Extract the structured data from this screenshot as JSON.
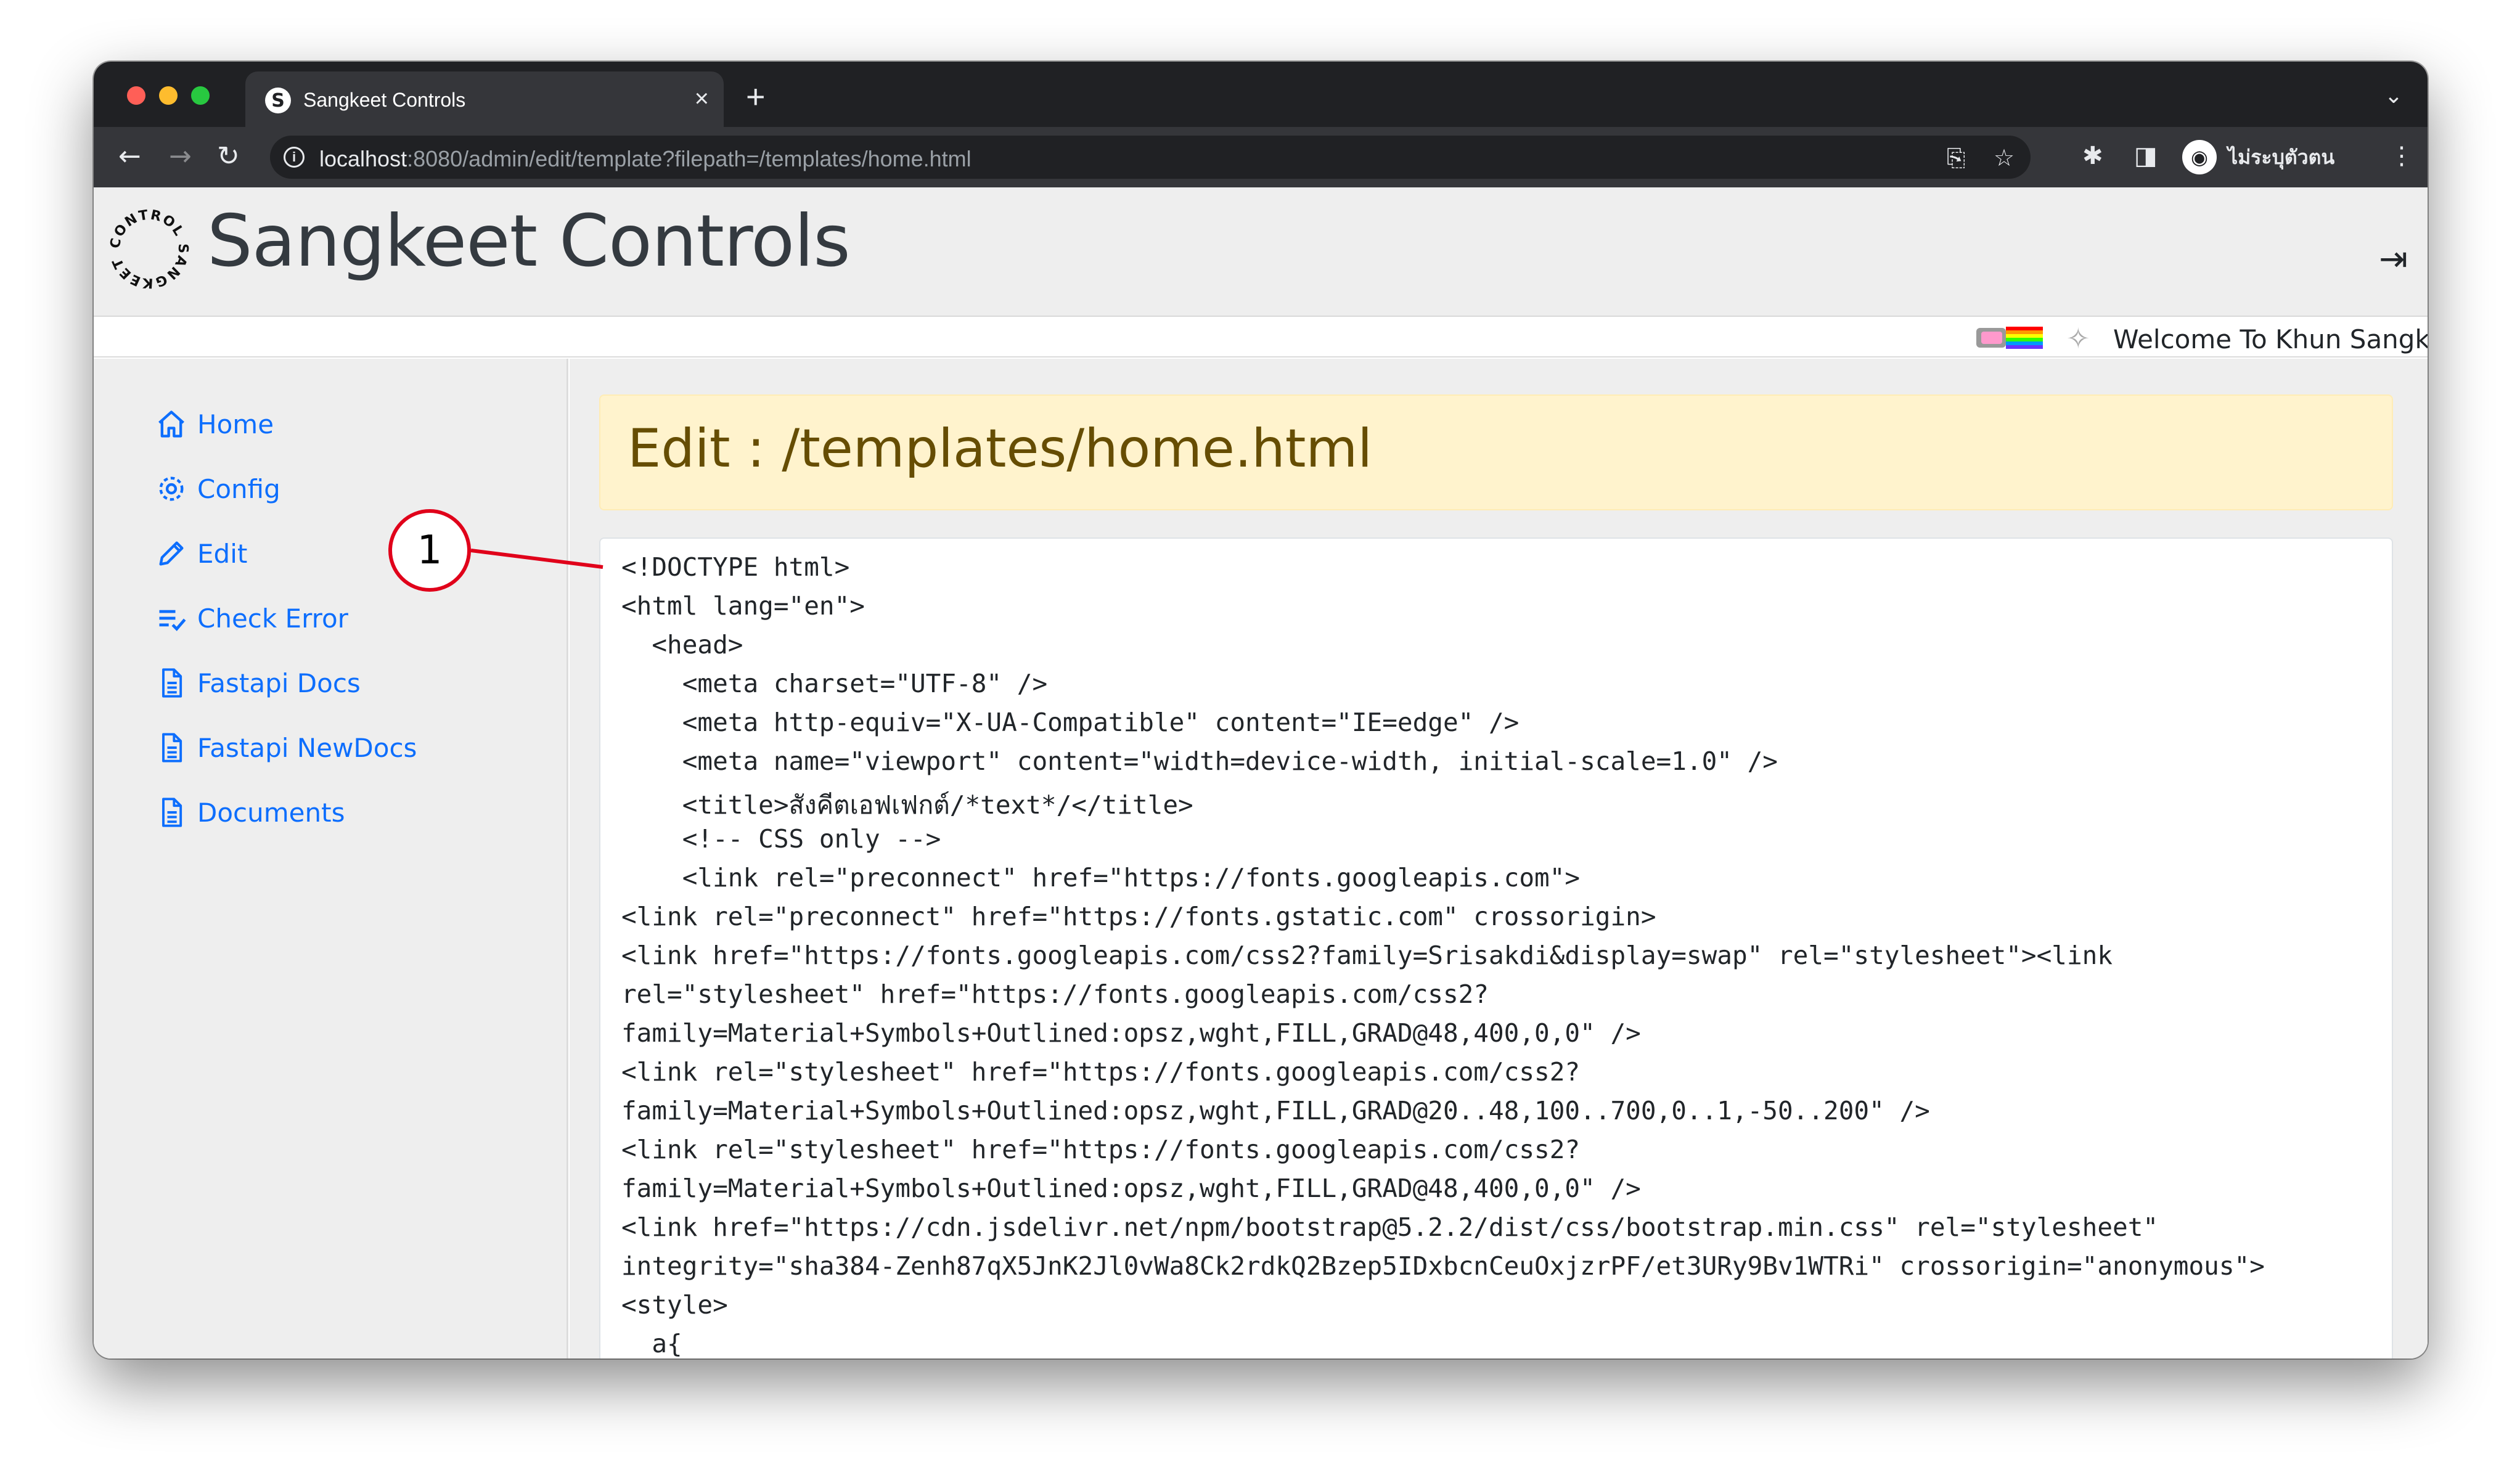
{
  "browser": {
    "tab_title": "Sangkeet Controls",
    "tab_close": "×",
    "new_tab": "+",
    "tab_menu": "⌄",
    "url_host": "localhost",
    "url_rest": ":8080/admin/edit/template?filepath=/templates/home.html",
    "profile_name": "ไม่ระบุตัวตน"
  },
  "app": {
    "title": "Sangkeet Controls",
    "logo_text": "CONTROL SANGKEET",
    "welcome": "Welcome To Khun Sangkeet"
  },
  "sidebar": {
    "items": [
      {
        "label": "Home",
        "icon": "home-icon"
      },
      {
        "label": "Config",
        "icon": "gear-icon"
      },
      {
        "label": "Edit",
        "icon": "pencil-icon"
      },
      {
        "label": "Check Error",
        "icon": "list-check-icon"
      },
      {
        "label": "Fastapi Docs",
        "icon": "document-icon"
      },
      {
        "label": "Fastapi NewDocs",
        "icon": "document-icon"
      },
      {
        "label": "Documents",
        "icon": "document-icon"
      }
    ]
  },
  "main": {
    "heading": "Edit : /templates/home.html",
    "code_lines": [
      "<!DOCTYPE html>",
      "<html lang=\"en\">",
      "  <head>",
      "    <meta charset=\"UTF-8\" />",
      "    <meta http-equiv=\"X-UA-Compatible\" content=\"IE=edge\" />",
      "    <meta name=\"viewport\" content=\"width=device-width, initial-scale=1.0\" />",
      "    <title>สังคีตเอฟเฟกต์/*text*/</title>",
      "    <!-- CSS only -->",
      "    <link rel=\"preconnect\" href=\"https://fonts.googleapis.com\">",
      "<link rel=\"preconnect\" href=\"https://fonts.gstatic.com\" crossorigin>",
      "<link href=\"https://fonts.googleapis.com/css2?family=Srisakdi&display=swap\" rel=\"stylesheet\"><link",
      "rel=\"stylesheet\" href=\"https://fonts.googleapis.com/css2?",
      "family=Material+Symbols+Outlined:opsz,wght,FILL,GRAD@48,400,0,0\" />",
      "<link rel=\"stylesheet\" href=\"https://fonts.googleapis.com/css2?",
      "family=Material+Symbols+Outlined:opsz,wght,FILL,GRAD@20..48,100..700,0..1,-50..200\" />",
      "<link rel=\"stylesheet\" href=\"https://fonts.googleapis.com/css2?",
      "family=Material+Symbols+Outlined:opsz,wght,FILL,GRAD@48,400,0,0\" />",
      "<link href=\"https://cdn.jsdelivr.net/npm/bootstrap@5.2.2/dist/css/bootstrap.min.css\" rel=\"stylesheet\"",
      "integrity=\"sha384-Zenh87qX5JnK2Jl0vWa8Ck2rdkQ2Bzep5IDxbcnCeuOxjzrPF/et3URy9Bv1WTRi\" crossorigin=\"anonymous\">",
      "<style>",
      "  a{"
    ]
  },
  "annotation": {
    "callout_number": "1"
  },
  "colors": {
    "link_blue": "#0d6efd",
    "banner_bg": "#fff3cd",
    "banner_text": "#664d03",
    "callout_red": "#e0001a"
  }
}
